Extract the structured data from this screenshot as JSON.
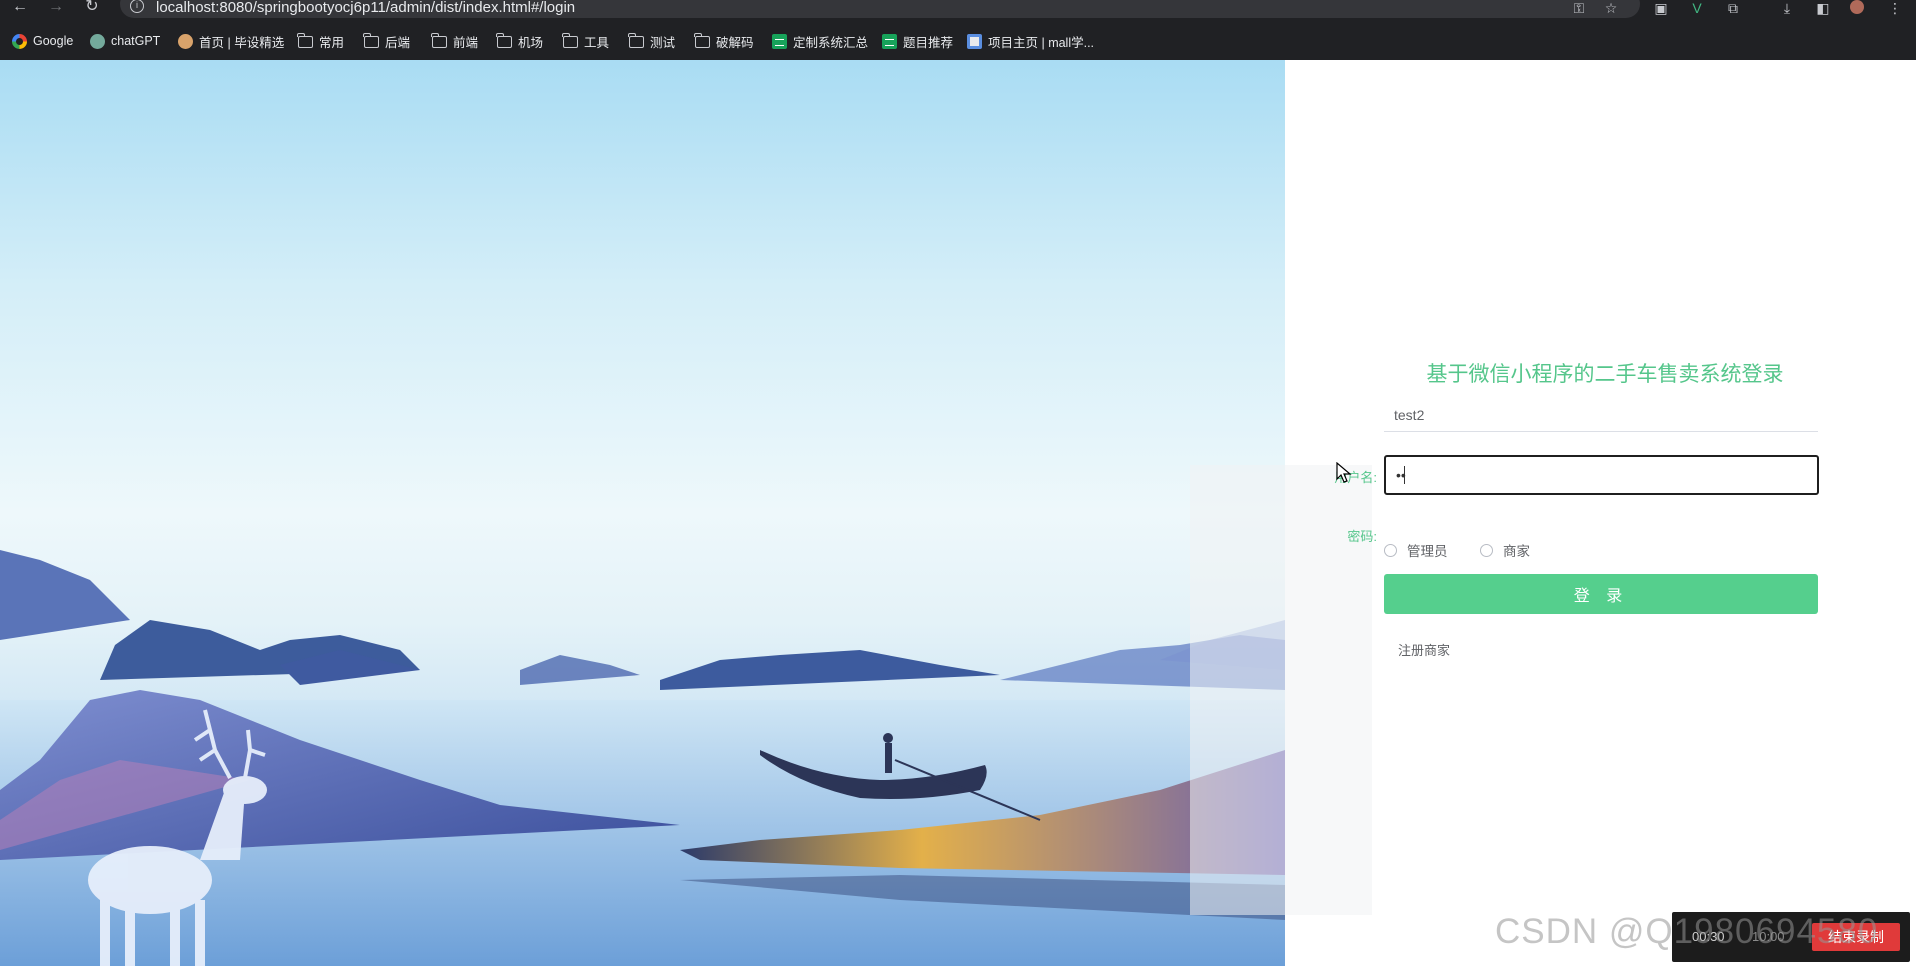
{
  "browser": {
    "url": "localhost:8080/springbootyocj6p11/admin/dist/index.html#/login",
    "bookmarks": [
      {
        "label": "Google",
        "icon": "google-icon"
      },
      {
        "label": "chatGPT",
        "icon": "chatgpt-icon"
      },
      {
        "label": "首页 | 毕设精选",
        "icon": "person-icon"
      },
      {
        "label": "常用",
        "icon": "folder-icon"
      },
      {
        "label": "后端",
        "icon": "folder-icon"
      },
      {
        "label": "前端",
        "icon": "folder-icon"
      },
      {
        "label": "机场",
        "icon": "folder-icon"
      },
      {
        "label": "工具",
        "icon": "folder-icon"
      },
      {
        "label": "测试",
        "icon": "folder-icon"
      },
      {
        "label": "破解码",
        "icon": "folder-icon"
      },
      {
        "label": "定制系统汇总",
        "icon": "sheet-icon"
      },
      {
        "label": "题目推荐",
        "icon": "sheet-icon"
      },
      {
        "label": "项目主页 | mall学...",
        "icon": "page-icon"
      }
    ]
  },
  "login": {
    "title": "基于微信小程序的二手车售卖系统登录",
    "username_label": "用户名:",
    "username_value": "test2",
    "password_label": "密码:",
    "password_value": "••",
    "roles": [
      "管理员",
      "商家"
    ],
    "login_button": "登 录",
    "register_link": "注册商家"
  },
  "overlay": {
    "watermark": "CSDN @Q1980694580",
    "recorder_time": "00:30",
    "recorder_time2": "10:00",
    "recorder_stop": "结束录制"
  },
  "colors": {
    "accent": "#55cf8d",
    "title": "#55c68b",
    "chrome": "#202124"
  }
}
